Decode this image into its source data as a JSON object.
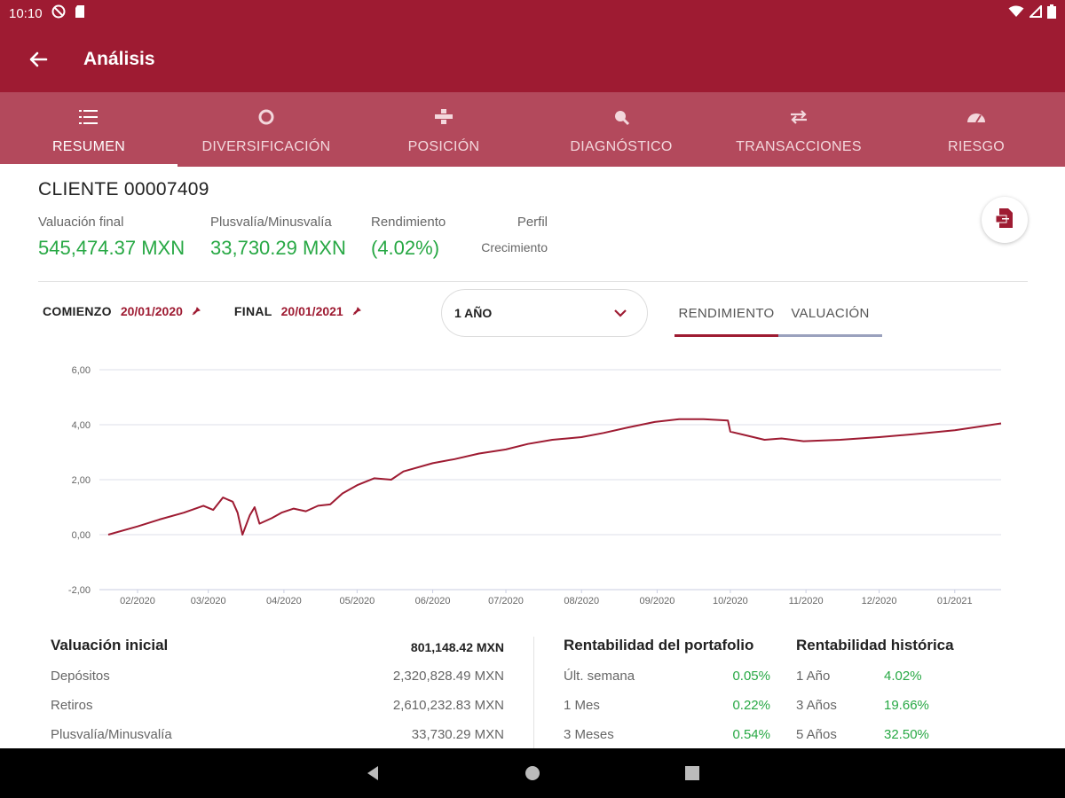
{
  "status_bar": {
    "time": "10:10"
  },
  "app_bar": {
    "title": "Análisis"
  },
  "tabs": [
    {
      "label": "RESUMEN",
      "icon": "list-icon",
      "active": true
    },
    {
      "label": "DIVERSIFICACIÓN",
      "icon": "donut-icon",
      "active": false
    },
    {
      "label": "POSICIÓN",
      "icon": "position-icon",
      "active": false
    },
    {
      "label": "DIAGNÓSTICO",
      "icon": "magnify-icon",
      "active": false
    },
    {
      "label": "TRANSACCIONES",
      "icon": "swap-icon",
      "active": false
    },
    {
      "label": "RIESGO",
      "icon": "gauge-icon",
      "active": false
    }
  ],
  "client": {
    "name": "CLIENTE 00007409"
  },
  "summary": {
    "final_valuation_label": "Valuación final",
    "final_valuation_value": "545,474.37 MXN",
    "gain_label": "Plusvalía/Minusvalía",
    "gain_value": "33,730.29 MXN",
    "yield_label": "Rendimiento",
    "yield_value": "(4.02%)",
    "profile_label": "Perfil",
    "profile_value": "Crecimiento"
  },
  "filters": {
    "start_label": "COMIENZO",
    "start_date": "20/01/2020",
    "end_label": "FINAL",
    "end_date": "20/01/2021",
    "period": "1 AÑO",
    "segments": [
      "RENDIMIENTO",
      "VALUACIÓN"
    ],
    "active_segment": "RENDIMIENTO"
  },
  "colors": {
    "brand": "#9e1b32",
    "tabs_bg": "#b3495c",
    "positive": "#27a844",
    "line": "#9e1b32"
  },
  "chart_data": {
    "type": "line",
    "y_ticks": [
      "6,00",
      "4,00",
      "2,00",
      "0,00",
      "-2,00"
    ],
    "ylim": [
      -2,
      6
    ],
    "x_ticks": [
      "02/2020",
      "03/2020",
      "04/2020",
      "05/2020",
      "06/2020",
      "07/2020",
      "08/2020",
      "09/2020",
      "10/2020",
      "11/2020",
      "12/2020",
      "01/2021"
    ],
    "xlim": [
      "2020-01-20",
      "2021-01-20"
    ],
    "grid": true,
    "series": [
      {
        "points": [
          [
            "2020-01-20",
            0.0
          ],
          [
            "2020-02-01",
            0.3
          ],
          [
            "2020-02-10",
            0.55
          ],
          [
            "2020-02-20",
            0.8
          ],
          [
            "2020-02-28",
            1.05
          ],
          [
            "2020-03-03",
            0.9
          ],
          [
            "2020-03-07",
            1.35
          ],
          [
            "2020-03-11",
            1.2
          ],
          [
            "2020-03-13",
            0.8
          ],
          [
            "2020-03-15",
            0.0
          ],
          [
            "2020-03-18",
            0.7
          ],
          [
            "2020-03-20",
            1.0
          ],
          [
            "2020-03-22",
            0.4
          ],
          [
            "2020-03-27",
            0.6
          ],
          [
            "2020-03-31",
            0.8
          ],
          [
            "2020-04-05",
            0.95
          ],
          [
            "2020-04-10",
            0.85
          ],
          [
            "2020-04-15",
            1.05
          ],
          [
            "2020-04-20",
            1.1
          ],
          [
            "2020-04-25",
            1.5
          ],
          [
            "2020-05-01",
            1.8
          ],
          [
            "2020-05-08",
            2.05
          ],
          [
            "2020-05-15",
            2.0
          ],
          [
            "2020-05-20",
            2.3
          ],
          [
            "2020-06-01",
            2.6
          ],
          [
            "2020-06-10",
            2.75
          ],
          [
            "2020-06-20",
            2.95
          ],
          [
            "2020-07-01",
            3.1
          ],
          [
            "2020-07-10",
            3.3
          ],
          [
            "2020-07-20",
            3.45
          ],
          [
            "2020-08-01",
            3.55
          ],
          [
            "2020-08-10",
            3.7
          ],
          [
            "2020-08-20",
            3.9
          ],
          [
            "2020-08-31",
            4.1
          ],
          [
            "2020-09-10",
            4.2
          ],
          [
            "2020-09-20",
            4.2
          ],
          [
            "2020-09-30",
            4.15
          ],
          [
            "2020-10-01",
            3.75
          ],
          [
            "2020-10-08",
            3.6
          ],
          [
            "2020-10-15",
            3.45
          ],
          [
            "2020-10-22",
            3.5
          ],
          [
            "2020-10-31",
            3.4
          ],
          [
            "2020-11-15",
            3.45
          ],
          [
            "2020-12-01",
            3.55
          ],
          [
            "2020-12-15",
            3.65
          ],
          [
            "2021-01-01",
            3.8
          ],
          [
            "2021-01-20",
            4.05
          ]
        ]
      }
    ]
  },
  "stats": {
    "initial_label": "Valuación inicial",
    "initial_value": "801,148.42 MXN",
    "rows": [
      {
        "label": "Depósitos",
        "value": "2,320,828.49 MXN"
      },
      {
        "label": "Retiros",
        "value": "2,610,232.83 MXN"
      },
      {
        "label": "Plusvalía/Minusvalía",
        "value": "33,730.29 MXN"
      }
    ],
    "portfolio_title": "Rentabilidad del portafolio",
    "portfolio_rows": [
      {
        "label": "Últ. semana",
        "value": "0.05%"
      },
      {
        "label": "1 Mes",
        "value": "0.22%"
      },
      {
        "label": "3 Meses",
        "value": "0.54%"
      }
    ],
    "historic_title": "Rentabilidad histórica",
    "historic_rows": [
      {
        "label": "1 Año",
        "value": "4.02%"
      },
      {
        "label": "3 Años",
        "value": "19.66%"
      },
      {
        "label": "5 Años",
        "value": "32.50%"
      }
    ]
  }
}
